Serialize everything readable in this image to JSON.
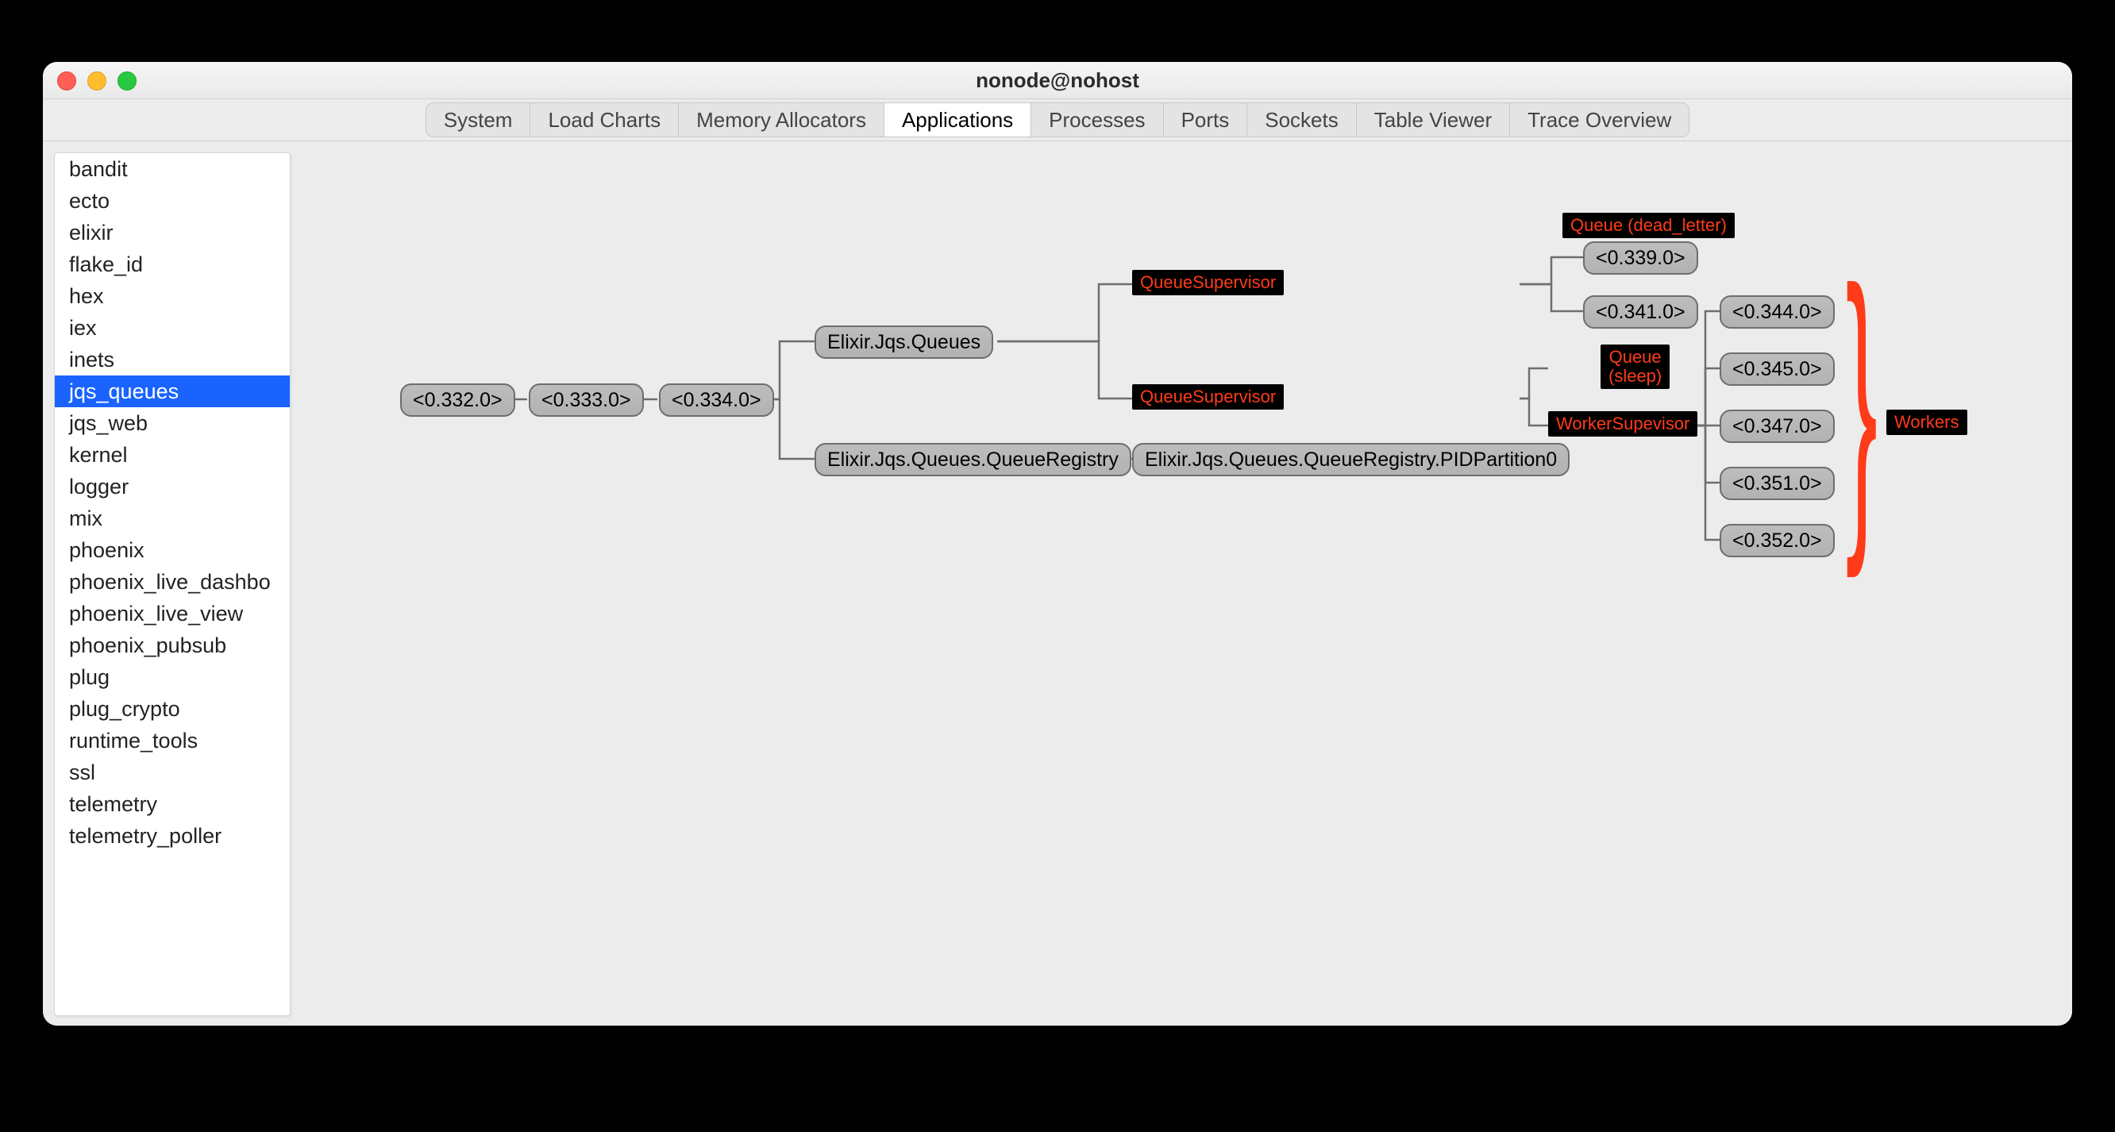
{
  "window": {
    "title": "nonode@nohost"
  },
  "tabs": [
    {
      "label": "System"
    },
    {
      "label": "Load Charts"
    },
    {
      "label": "Memory Allocators"
    },
    {
      "label": "Applications",
      "active": true
    },
    {
      "label": "Processes"
    },
    {
      "label": "Ports"
    },
    {
      "label": "Sockets"
    },
    {
      "label": "Table Viewer"
    },
    {
      "label": "Trace Overview"
    }
  ],
  "sidebar": {
    "items": [
      "bandit",
      "ecto",
      "elixir",
      "flake_id",
      "hex",
      "iex",
      "inets",
      "jqs_queues",
      "jqs_web",
      "kernel",
      "logger",
      "mix",
      "phoenix",
      "phoenix_live_dashbo",
      "phoenix_live_view",
      "phoenix_pubsub",
      "plug",
      "plug_crypto",
      "runtime_tools",
      "ssl",
      "telemetry",
      "telemetry_poller"
    ],
    "selected": "jqs_queues"
  },
  "tree": {
    "nodes": {
      "n332": "<0.332.0>",
      "n333": "<0.333.0>",
      "n334": "<0.334.0>",
      "queues": "Elixir.Jqs.Queues",
      "registry": "Elixir.Jqs.Queues.QueueRegistry",
      "registryPartition": "Elixir.Jqs.Queues.QueueRegistry.PIDPartition0",
      "n339": "<0.339.0>",
      "n341": "<0.341.0>",
      "n344": "<0.344.0>",
      "n345": "<0.345.0>",
      "n347": "<0.347.0>",
      "n351": "<0.351.0>",
      "n352": "<0.352.0>"
    },
    "annotations": {
      "qsup1": "QueueSupervisor",
      "qsup2": "QueueSupervisor",
      "qDead": "Queue (dead_letter)",
      "qSleep": "Queue\n(sleep)",
      "wsup": "WorkerSupevisor",
      "workers": "Workers"
    }
  }
}
